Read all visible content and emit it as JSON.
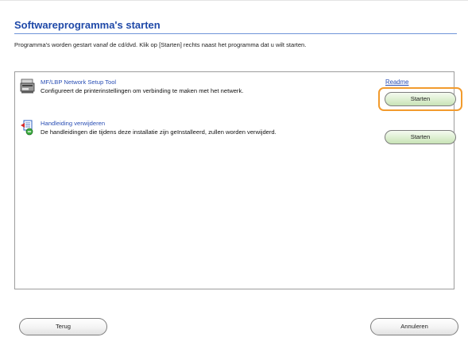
{
  "header": {
    "title": "Softwareprogramma's starten",
    "instruction": "Programma's worden gestart vanaf de cd/dvd. Klik op [Starten] rechts naast het programma dat u wilt starten."
  },
  "programs": [
    {
      "name": "MF/LBP Network Setup Tool",
      "description": "Configureert de printerinstellingen om verbinding te maken met het netwerk.",
      "readme_label": "Readme",
      "start_label": "Starten",
      "icon": "printer-icon"
    },
    {
      "name": "Handleiding verwijderen",
      "description": "De handleidingen die tijdens deze installatie zijn geïnstalleerd, zullen worden verwijderd.",
      "start_label": "Starten",
      "icon": "uninstall-manual-icon"
    }
  ],
  "footer": {
    "back_label": "Terug",
    "cancel_label": "Annuleren"
  },
  "colors": {
    "title": "#1f49a8",
    "link": "#2a4fb5",
    "highlight": "#f29b2d",
    "start_button": "#d7ecc9"
  }
}
